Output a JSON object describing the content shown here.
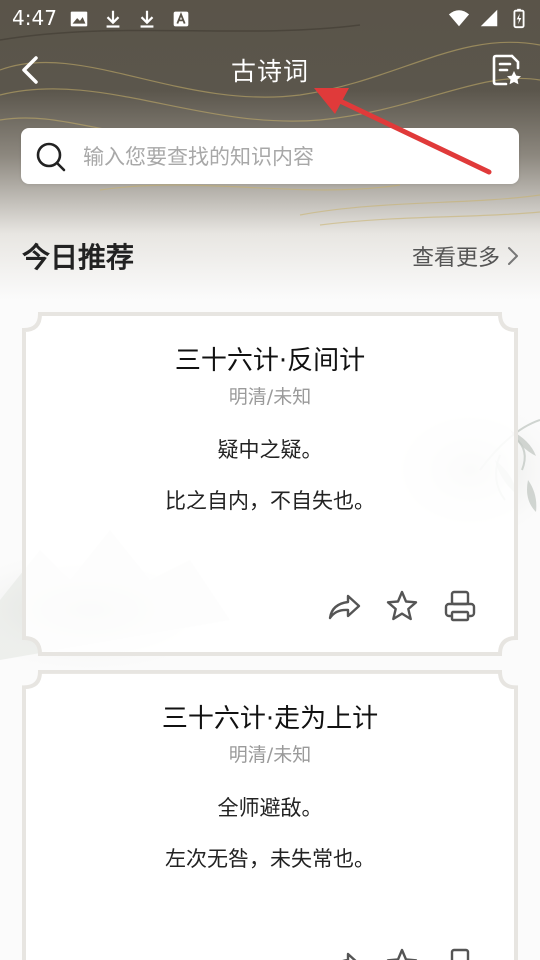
{
  "status_bar": {
    "time": "4:47",
    "left_icons": [
      "image-icon",
      "download-icon",
      "download-icon",
      "app-a-icon"
    ],
    "right_icons": [
      "wifi-icon",
      "signal-icon",
      "battery-icon"
    ]
  },
  "header": {
    "title": "古诗词"
  },
  "search": {
    "placeholder": "输入您要查找的知识内容"
  },
  "section": {
    "title": "今日推荐",
    "see_more": "查看更多"
  },
  "cards": [
    {
      "title": "三十六计·反间计",
      "author": "明清/未知",
      "lines": [
        "疑中之疑。",
        "比之自内，不自失也。"
      ],
      "actions": [
        "share-icon",
        "star-icon",
        "print-icon"
      ]
    },
    {
      "title": "三十六计·走为上计",
      "author": "明清/未知",
      "lines": [
        "全师避敌。",
        "左次无咎，未失常也。"
      ],
      "actions": [
        "share-icon",
        "star-icon",
        "print-icon"
      ]
    }
  ],
  "colors": {
    "header_bg": "#5a5449",
    "annotation_arrow": "#e03a3a",
    "card_border": "#e7e5e1",
    "gold_lines": "#c9b26a"
  }
}
